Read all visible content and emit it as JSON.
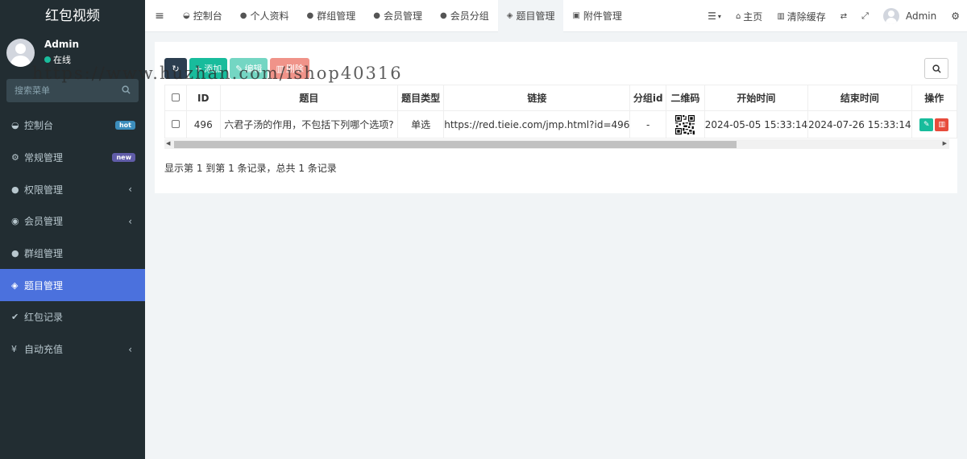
{
  "sidebar": {
    "logo": "红包视频",
    "user": {
      "name": "Admin",
      "status": "在线"
    },
    "search_placeholder": "搜索菜单",
    "items": [
      {
        "label": "控制台",
        "icon": "dashboard-icon",
        "badge": "hot"
      },
      {
        "label": "常规管理",
        "icon": "cogs-icon",
        "badge": "new"
      },
      {
        "label": "权限管理",
        "icon": "group-icon"
      },
      {
        "label": "会员管理",
        "icon": "user-circle-icon"
      },
      {
        "label": "群组管理",
        "icon": "users-icon"
      },
      {
        "label": "题目管理",
        "icon": "cube-icon",
        "active": true
      },
      {
        "label": "红包记录",
        "icon": "check-circle-icon"
      },
      {
        "label": "自动充值",
        "icon": "yen-icon"
      }
    ]
  },
  "topbar": {
    "tabs": [
      {
        "label": "控制台",
        "icon": "dashboard-icon"
      },
      {
        "label": "个人资料",
        "icon": "user-icon"
      },
      {
        "label": "群组管理",
        "icon": "users-icon"
      },
      {
        "label": "会员管理",
        "icon": "user-icon"
      },
      {
        "label": "会员分组",
        "icon": "users-icon"
      },
      {
        "label": "题目管理",
        "icon": "cube-icon",
        "active": true
      },
      {
        "label": "附件管理",
        "icon": "image-icon"
      }
    ],
    "home_label": "主页",
    "clear_cache_label": "清除缓存",
    "user_name": "Admin"
  },
  "toolbar": {
    "add_label": "添加",
    "edit_label": "编辑",
    "delete_label": "删除"
  },
  "table": {
    "headers": [
      "ID",
      "题目",
      "题目类型",
      "链接",
      "分组id",
      "二维码",
      "开始时间",
      "结束时间",
      "操作"
    ],
    "rows": [
      {
        "id": "496",
        "title": "六君子汤的作用，不包括下列哪个选项?",
        "type": "单选",
        "link": "https://red.tieie.com/jmp.html?id=496",
        "group_id": "-",
        "start_time": "2024-05-05 15:33:14",
        "end_time": "2024-07-26 15:33:14"
      }
    ]
  },
  "pager_text": "显示第 1 到第 1 条记录，总共 1 条记录",
  "watermark": "https://www.huzhan.com/ishop40316",
  "colors": {
    "sidebar": "#222d32",
    "active": "#4b71dd",
    "success": "#18bc9c",
    "danger": "#e74c3c"
  }
}
